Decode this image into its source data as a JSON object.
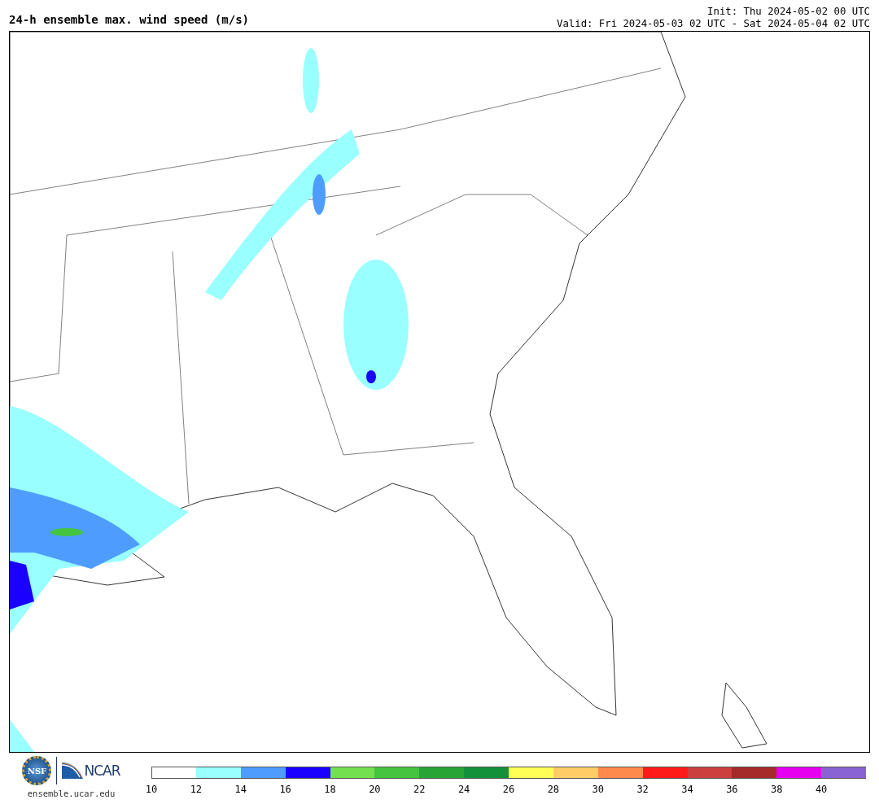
{
  "header": {
    "title": "24-h ensemble max. wind speed (m/s)",
    "init": "Init: Thu 2024-05-02 00 UTC",
    "valid": "Valid: Fri 2024-05-03 02 UTC - Sat 2024-05-04 02 UTC"
  },
  "footer": {
    "nsf_logo": "NSF",
    "ncar_logo": "NCAR",
    "url": "ensemble.ucar.edu"
  },
  "colorbar": {
    "bins": [
      {
        "color": "#ffffff"
      },
      {
        "color": "#99ffff"
      },
      {
        "color": "#4f9cff"
      },
      {
        "color": "#1a00ff"
      },
      {
        "color": "#73e04f"
      },
      {
        "color": "#44c43f"
      },
      {
        "color": "#27a434"
      },
      {
        "color": "#13903a"
      },
      {
        "color": "#ffff55"
      },
      {
        "color": "#ffcc66"
      },
      {
        "color": "#ff8a4c"
      },
      {
        "color": "#ff1a1a"
      },
      {
        "color": "#cc3f3f"
      },
      {
        "color": "#a52a2a"
      },
      {
        "color": "#e600f0"
      },
      {
        "color": "#8a63d2"
      }
    ],
    "ticks": [
      "10",
      "12",
      "14",
      "16",
      "18",
      "20",
      "22",
      "24",
      "26",
      "28",
      "30",
      "32",
      "34",
      "36",
      "38",
      "40"
    ]
  }
}
